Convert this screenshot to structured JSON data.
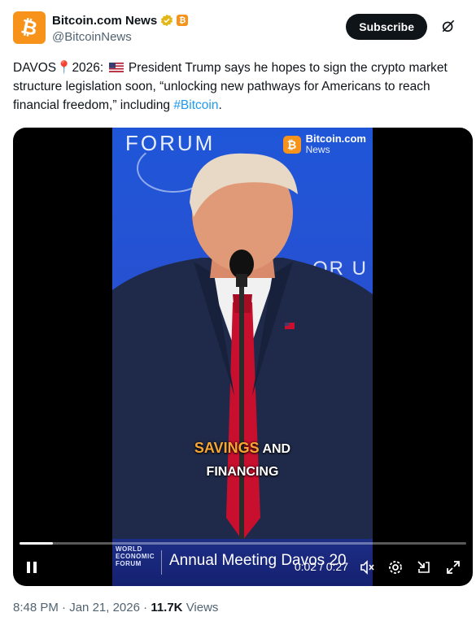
{
  "author": {
    "display_name": "Bitcoin.com News",
    "handle": "@BitcoinNews",
    "avatar_letter": "₿",
    "affiliate_letter": "₿",
    "brand_color": "#f7931a",
    "verified_color": "#e2b719"
  },
  "actions": {
    "subscribe_label": "Subscribe",
    "grok_icon": "grok-icon"
  },
  "tweet": {
    "text_1": "DAVOS",
    "text_2": "2026:",
    "text_3": "President Trump says he hopes to sign the crypto market structure legislation soon, “unlocking new pathways for Americans to reach financial freedom,” including",
    "hashtag": "#Bitcoin",
    "text_4": ".",
    "pin_icon": "📍",
    "hashtag_color": "#1d9bf0"
  },
  "video": {
    "backdrop_text_top": "FORUM",
    "backdrop_text_side": "OR U",
    "watermark_brand": "Bitcoin.com",
    "watermark_sub": "News",
    "caption_highlight": "SAVINGS",
    "caption_rest_1": "AND",
    "caption_line_2": "FINANCING",
    "banner_logo_lines": [
      "WORLD",
      "ECONOMIC",
      "FORUM"
    ],
    "banner_text": "Annual Meeting Davos 20",
    "current_time": "0:02",
    "duration": "0:27",
    "time_separator": "/",
    "progress_fraction": 0.074,
    "controls": [
      "pause-icon",
      "mute-icon",
      "settings-icon",
      "minimize-icon",
      "fullscreen-icon"
    ]
  },
  "meta": {
    "time": "8:48 PM",
    "date": "Jan 21, 2026",
    "views_count": "11.7K",
    "views_label": "Views",
    "sep": "·"
  }
}
